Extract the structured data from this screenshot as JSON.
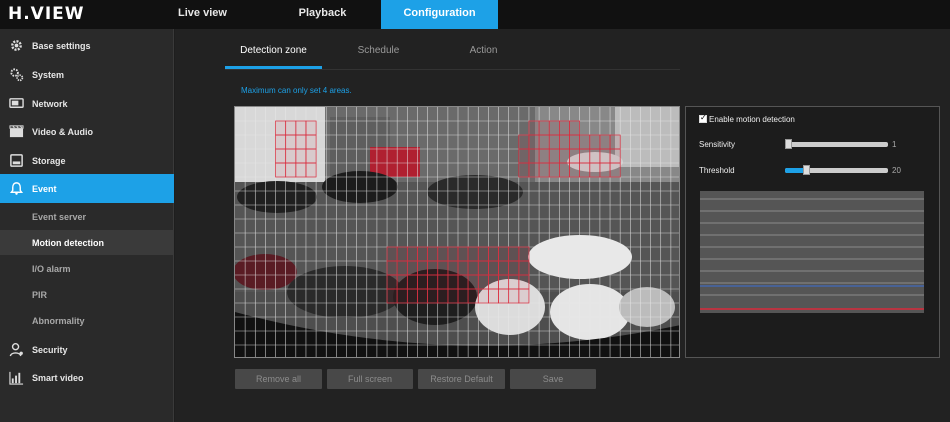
{
  "brand": {
    "logo": "H.VIEW"
  },
  "nav": {
    "tabs": [
      {
        "label": "Live view"
      },
      {
        "label": "Playback"
      },
      {
        "label": "Configuration"
      }
    ]
  },
  "sidebar": {
    "items": [
      {
        "label": "Base settings",
        "icon": "gear-icon"
      },
      {
        "label": "System",
        "icon": "gears-icon"
      },
      {
        "label": "Network",
        "icon": "network-icon"
      },
      {
        "label": "Video & Audio",
        "icon": "video-icon"
      },
      {
        "label": "Storage",
        "icon": "storage-icon"
      },
      {
        "label": "Event",
        "icon": "bell-icon"
      }
    ],
    "event_sub": [
      {
        "label": "Event server"
      },
      {
        "label": "Motion detection"
      },
      {
        "label": "I/O alarm"
      },
      {
        "label": "PIR"
      },
      {
        "label": "Abnormality"
      }
    ],
    "bottom_items": [
      {
        "label": "Security",
        "icon": "user-icon"
      },
      {
        "label": "Smart video",
        "icon": "chart-icon"
      }
    ]
  },
  "subtabs": [
    {
      "label": "Detection zone"
    },
    {
      "label": "Schedule"
    },
    {
      "label": "Action"
    }
  ],
  "hint": "Maximum can only set 4 areas.",
  "buttons": {
    "remove_all": "Remove all",
    "full_screen": "Full screen",
    "restore_default": "Restore Default",
    "save": "Save"
  },
  "motion": {
    "enable_label": "Enable motion detection",
    "enabled": true,
    "sensitivity_label": "Sensitivity",
    "sensitivity_value": "1",
    "sensitivity_fraction": 0.0,
    "threshold_label": "Threshold",
    "threshold_value": "20",
    "threshold_fraction": 0.2
  },
  "colors": {
    "accent": "#1da1e7",
    "zone_red": "#d9293b"
  }
}
